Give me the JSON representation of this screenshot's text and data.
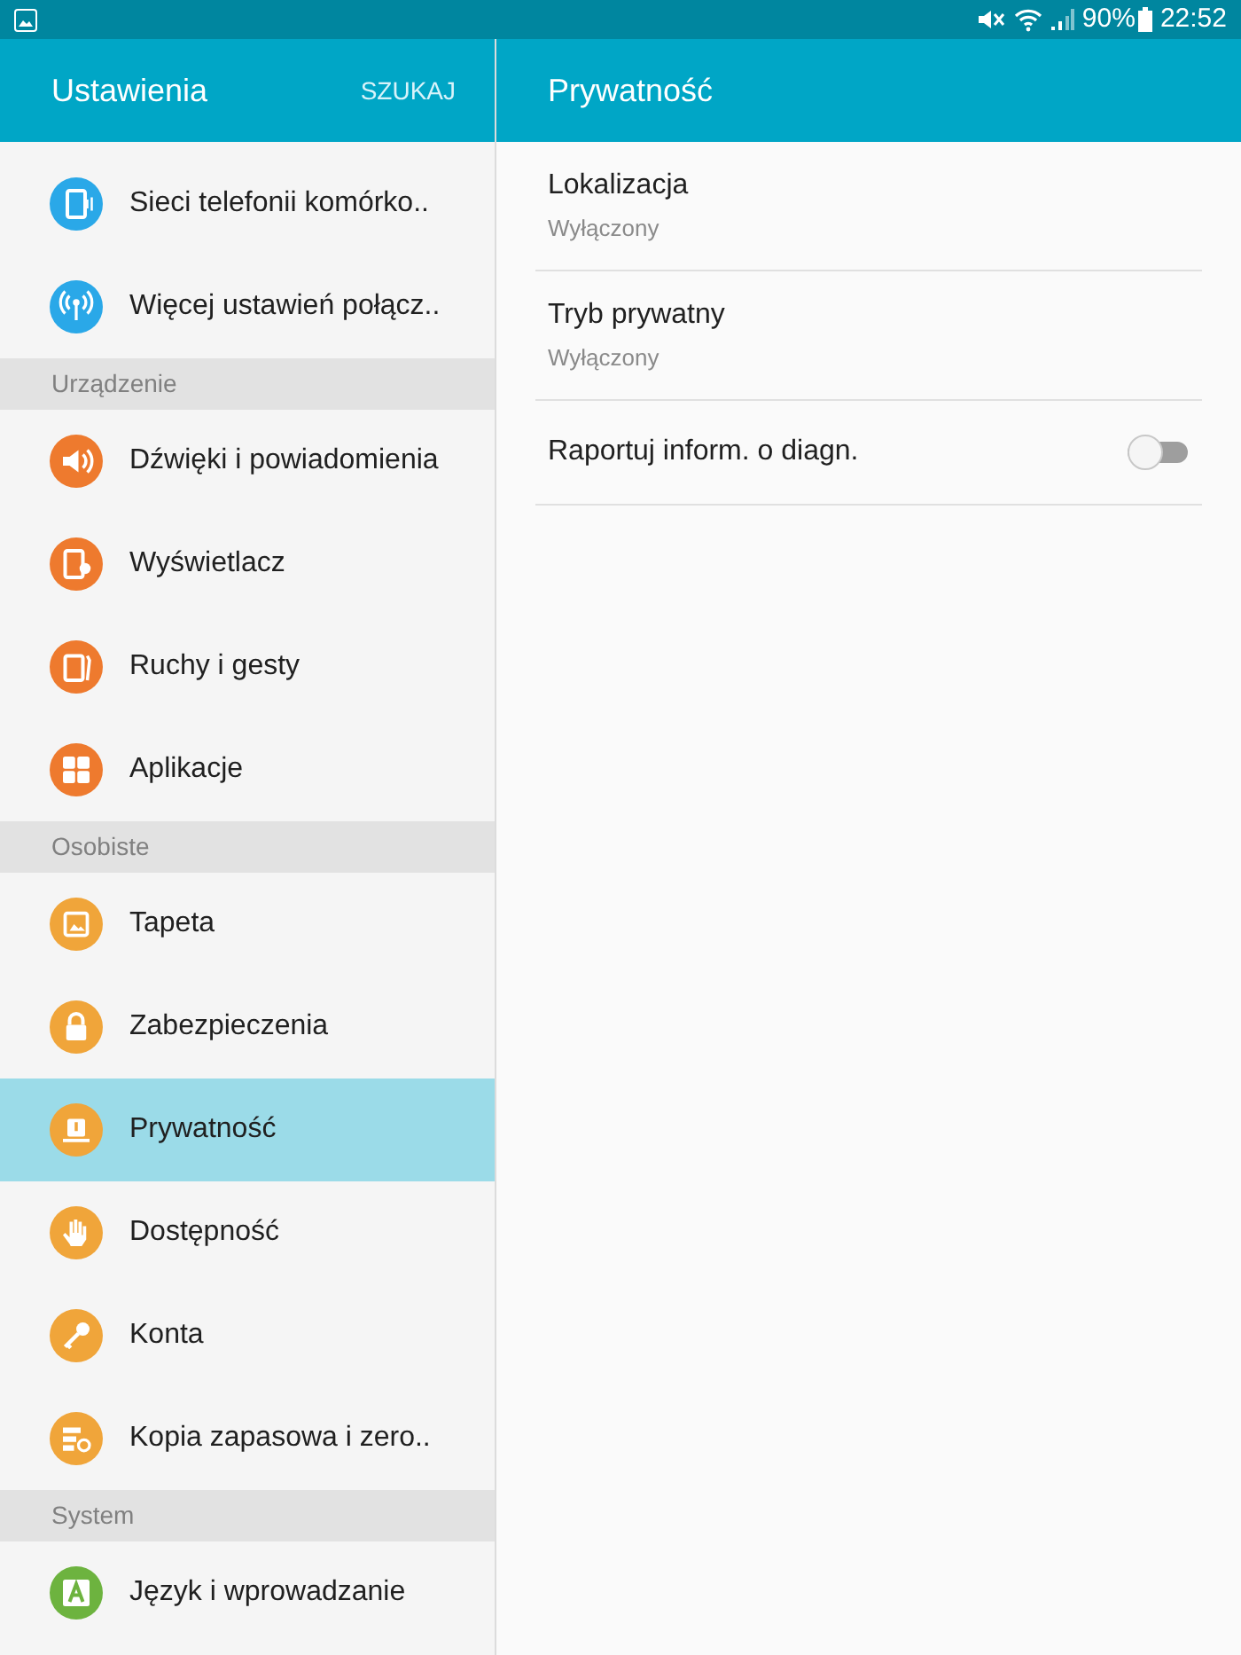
{
  "status_bar": {
    "battery": "90%",
    "time": "22:52"
  },
  "sidebar": {
    "title": "Ustawienia",
    "search_button": "SZUKAJ",
    "entries": [
      {
        "kind": "item",
        "label": "Sieci telefonii komórko..",
        "color": "#2aa8e8",
        "selected": false
      },
      {
        "kind": "item",
        "label": "Więcej ustawień połącz..",
        "color": "#2aa8e8",
        "selected": false
      },
      {
        "kind": "section",
        "label": "Urządzenie"
      },
      {
        "kind": "item",
        "label": "Dźwięki i powiadomienia",
        "color": "#ee7a2e",
        "selected": false
      },
      {
        "kind": "item",
        "label": "Wyświetlacz",
        "color": "#ee7a2e",
        "selected": false
      },
      {
        "kind": "item",
        "label": "Ruchy i gesty",
        "color": "#ee7a2e",
        "selected": false
      },
      {
        "kind": "item",
        "label": "Aplikacje",
        "color": "#ee7a2e",
        "selected": false
      },
      {
        "kind": "section",
        "label": "Osobiste"
      },
      {
        "kind": "item",
        "label": "Tapeta",
        "color": "#f0a53a",
        "selected": false
      },
      {
        "kind": "item",
        "label": "Zabezpieczenia",
        "color": "#f0a53a",
        "selected": false
      },
      {
        "kind": "item",
        "label": "Prywatność",
        "color": "#f0a53a",
        "selected": true
      },
      {
        "kind": "item",
        "label": "Dostępność",
        "color": "#f0a53a",
        "selected": false
      },
      {
        "kind": "item",
        "label": "Konta",
        "color": "#f0a53a",
        "selected": false
      },
      {
        "kind": "item",
        "label": "Kopia zapasowa i zero..",
        "color": "#f0a53a",
        "selected": false
      },
      {
        "kind": "section",
        "label": "System"
      },
      {
        "kind": "item",
        "label": "Język i wprowadzanie",
        "color": "#6db33f",
        "selected": false
      }
    ]
  },
  "detail": {
    "title": "Prywatność",
    "items": [
      {
        "kind": "link",
        "title": "Lokalizacja",
        "subtitle": "Wyłączony"
      },
      {
        "kind": "link",
        "title": "Tryb prywatny",
        "subtitle": "Wyłączony"
      },
      {
        "kind": "toggle",
        "title": "Raportuj inform. o diagn.",
        "on": false
      }
    ]
  }
}
